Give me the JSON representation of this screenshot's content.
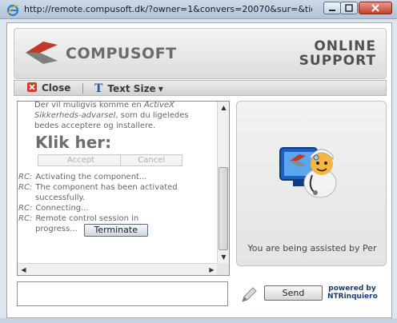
{
  "window": {
    "url": "http://remote.compusoft.dk/?owner=1&convers=20070&sur=&tic..."
  },
  "header": {
    "logo_text": "COMPUSOFT",
    "title_line1": "ONLINE",
    "title_line2": "SUPPORT"
  },
  "toolbar": {
    "close_label": "Close",
    "text_size_label": "Text Size"
  },
  "chat": {
    "intro_1": "Der vil muligvis komme en",
    "intro_em1": "ActiveX",
    "intro_em2": "Sikkerheds-advarsel",
    "intro_2": ", som du ligeledes",
    "intro_3": "bedes acceptere og installere.",
    "klik": "Klik her:",
    "accept_label": "Accept",
    "cancel_label": "Cancel",
    "log": [
      {
        "prefix": "RC:",
        "text": "Activating the component..."
      },
      {
        "prefix": "RC:",
        "text": "The component has been activated",
        "cont": "successfully."
      },
      {
        "prefix": "RC:",
        "text": "Connecting..."
      },
      {
        "prefix": "RC:",
        "text": "Remote control session in",
        "cont": "progress..."
      }
    ],
    "terminate_label": "Terminate"
  },
  "info": {
    "assist_text": "You are being assisted by Per"
  },
  "composer": {
    "input_value": "",
    "send_label": "Send",
    "powered_line1": "powered by",
    "powered_line2": "NTRinquiero"
  },
  "colors": {
    "close_icon_red": "#d23a2a",
    "logo_red": "#c0392b",
    "brand_blue": "#1b3b6f"
  }
}
